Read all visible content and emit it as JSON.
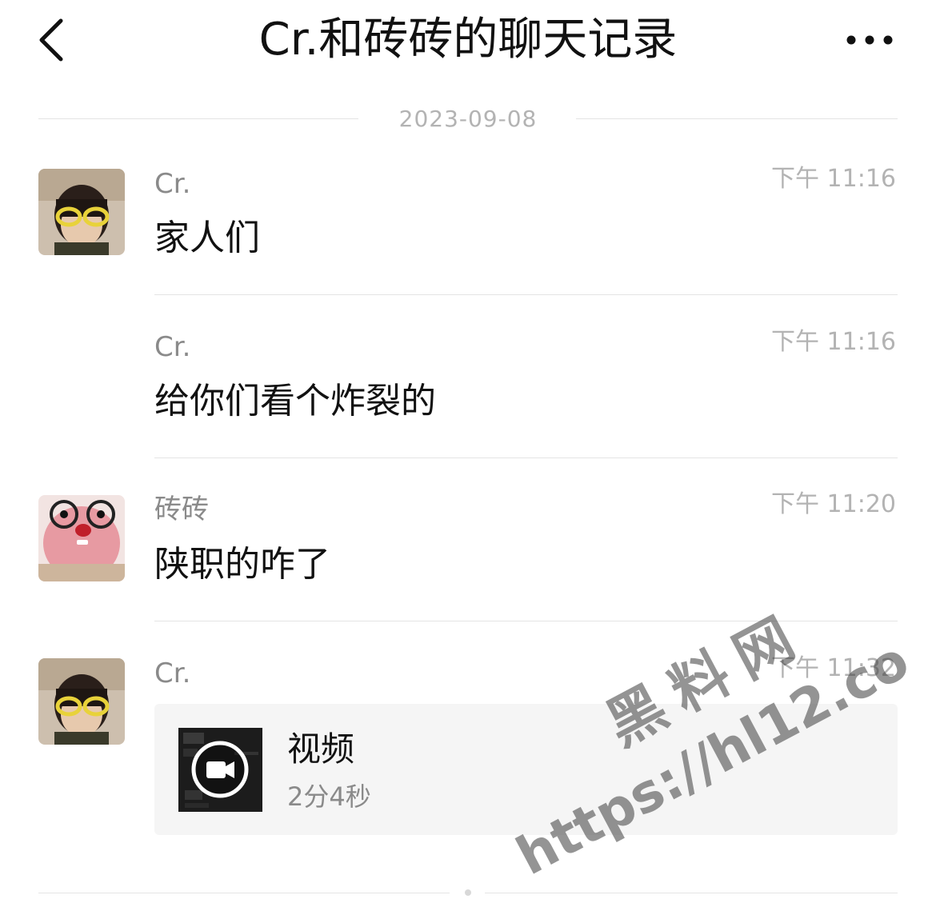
{
  "header": {
    "title": "Cr.和砖砖的聊天记录",
    "back_icon": "chevron-left-icon",
    "more_icon": "more-horizontal-icon"
  },
  "date_separator": "2023-09-08",
  "messages": [
    {
      "sender": "Cr.",
      "time": "下午 11:16",
      "text": "家人们"
    },
    {
      "sender": "Cr.",
      "time": "下午 11:16",
      "text": "给你们看个炸裂的"
    },
    {
      "sender": "砖砖",
      "time": "下午 11:20",
      "text": "陕职的咋了"
    },
    {
      "sender": "Cr.",
      "time": "下午 11:32",
      "video": {
        "title": "视频",
        "duration": "2分4秒",
        "icon": "video-camera-icon"
      }
    }
  ],
  "watermark": {
    "line1": "黑料网",
    "line2": "https://hl12.co"
  },
  "colors": {
    "text_primary": "#111111",
    "text_secondary": "#8a8a8a",
    "text_tertiary": "#b3b3b3",
    "divider": "#e4e4e4",
    "card_bg": "#f5f5f5"
  }
}
